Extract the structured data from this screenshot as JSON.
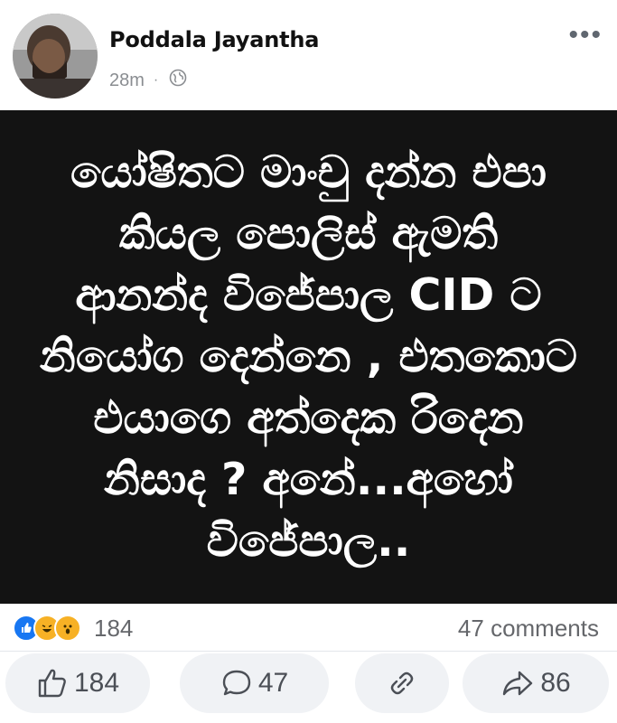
{
  "post": {
    "author": "Poddala Jayantha",
    "time": "28m",
    "separator": "·",
    "privacy_icon": "globe-icon",
    "more_icon": "more-options-icon",
    "text": "යෝෂිතට මාංචු දන්න එපා\nකියල පොලිස් ඇමති\nආනන්ද විජේපාල CID ට\nනියෝග දෙන්නෙ , එතකොට\nඑයාගෙ අත්දෙක රිදෙන\nනිසාද ?  අනේ...අහෝ\nවිජේපාල..",
    "card_background": "#131313"
  },
  "reactions": {
    "icons": [
      "like-reaction-icon",
      "haha-reaction-icon",
      "wow-reaction-icon"
    ],
    "count": "184",
    "comments": "47 comments"
  },
  "actions": {
    "like_count": "184",
    "comment_count": "47",
    "share_count": "86"
  },
  "colors": {
    "accent": "#1877f2",
    "muted": "#65676b",
    "button_bg": "#f0f2f5"
  }
}
